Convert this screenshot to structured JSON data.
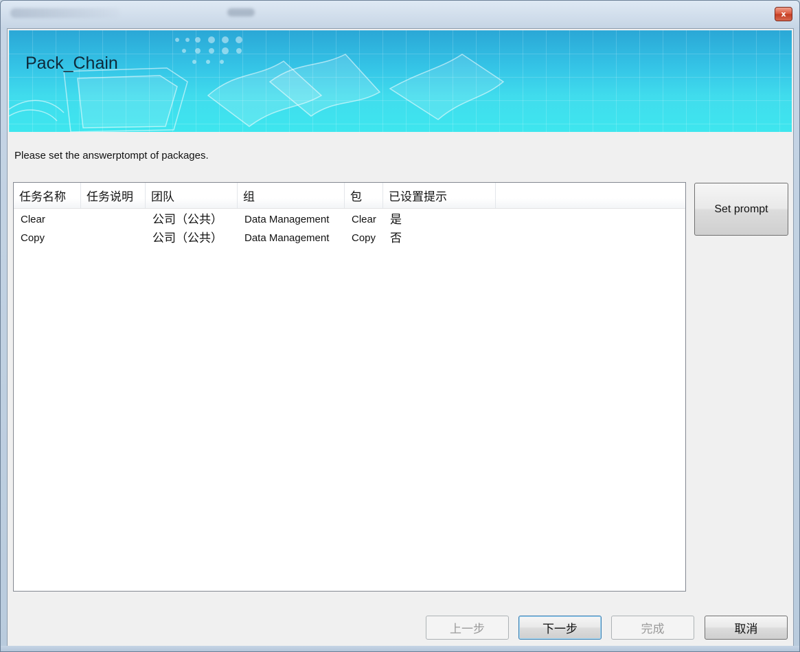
{
  "window": {
    "close_glyph": "x"
  },
  "banner": {
    "title": "Pack_Chain"
  },
  "instruction": "Please set the answerptompt of packages.",
  "table": {
    "columns": [
      "任务名称",
      "任务说明",
      "团队",
      "组",
      "包",
      "已设置提示"
    ],
    "rows": [
      [
        "Clear",
        "",
        "公司（公共）",
        "Data Management",
        "Clear",
        "是"
      ],
      [
        "Copy",
        "",
        "公司（公共）",
        "Data Management",
        "Copy",
        "否"
      ]
    ]
  },
  "side_buttons": {
    "set_prompt": "Set prompt"
  },
  "footer_buttons": {
    "back": "上一步",
    "next": "下一步",
    "finish": "完成",
    "cancel": "取消"
  },
  "colors": {
    "banner_top": "#2aa7d6",
    "banner_bottom": "#3ee6ee",
    "close_button": "#c23b22"
  },
  "icons": {
    "close": "close-icon"
  }
}
